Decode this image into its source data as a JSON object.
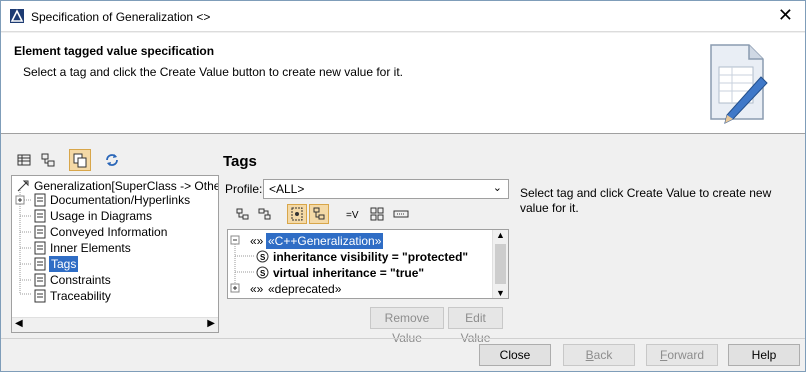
{
  "window": {
    "title": "Specification of Generalization <>"
  },
  "header": {
    "title": "Element tagged value specification",
    "subtitle": "Select a tag and click the Create Value button to create new value for it."
  },
  "tree": {
    "root": "Generalization[SuperClass -> OtherBas",
    "items": [
      {
        "label": "Documentation/Hyperlinks"
      },
      {
        "label": "Usage in Diagrams"
      },
      {
        "label": "Conveyed Information"
      },
      {
        "label": "Inner Elements"
      },
      {
        "label": "Tags",
        "selected": true
      },
      {
        "label": "Constraints"
      },
      {
        "label": "Traceability"
      }
    ]
  },
  "panel": {
    "title": "Tags",
    "profile_label": "Profile:",
    "profile_value": "<ALL>",
    "description": "Select tag and click Create Value to create new value for it."
  },
  "tags": {
    "group1_prefix": "«»",
    "group1": "«C++Generalization»",
    "item1": "inheritance visibility = \"protected\"",
    "item2": "virtual inheritance = \"true\"",
    "group2_prefix": "«»",
    "group2": "«deprecated»"
  },
  "buttons": {
    "remove_value": "Remove Value",
    "edit_value": "Edit Value",
    "close": "Close",
    "back_u": "B",
    "back_rest": "ack",
    "forward_u": "F",
    "forward_rest": "orward",
    "help": "Help"
  },
  "colors": {
    "selection": "#2f6dc5",
    "pressed": "#f4d9a6",
    "accent": "#3c82c8"
  }
}
